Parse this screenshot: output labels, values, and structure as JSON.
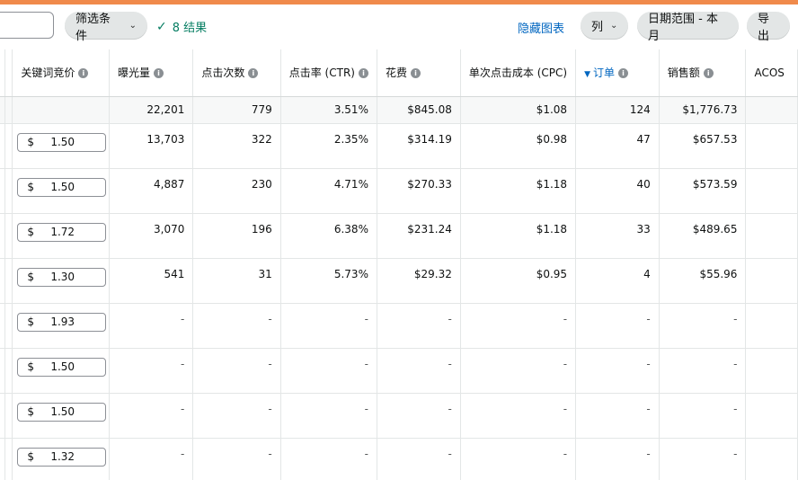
{
  "toolbar": {
    "filter_label": "筛选条件",
    "result_text": "8 结果",
    "hide_chart_label": "隐藏图表",
    "columns_label": "列",
    "date_range_label": "日期范围 - 本月",
    "export_label": "导出"
  },
  "colors": {
    "accent_top": "#f08a4b",
    "link": "#0066c0",
    "success": "#067d62"
  },
  "table": {
    "headers": [
      "关键词竞价",
      "曝光量",
      "点击次数",
      "点击率 (CTR)",
      "花费",
      "单次点击成本 (CPC)",
      "订单",
      "销售额",
      "ACOS"
    ],
    "sorted_header": "订单",
    "summary": [
      "",
      "22,201",
      "779",
      "3.51%",
      "$845.08",
      "$1.08",
      "124",
      "$1,776.73",
      ""
    ],
    "currency": "$",
    "rows": [
      {
        "bid": "1.50",
        "cells": [
          "13,703",
          "322",
          "2.35%",
          "$314.19",
          "$0.98",
          "47",
          "$657.53",
          ""
        ]
      },
      {
        "bid": "1.50",
        "cells": [
          "4,887",
          "230",
          "4.71%",
          "$270.33",
          "$1.18",
          "40",
          "$573.59",
          ""
        ]
      },
      {
        "bid": "1.72",
        "cells": [
          "3,070",
          "196",
          "6.38%",
          "$231.24",
          "$1.18",
          "33",
          "$489.65",
          ""
        ]
      },
      {
        "bid": "1.30",
        "cells": [
          "541",
          "31",
          "5.73%",
          "$29.32",
          "$0.95",
          "4",
          "$55.96",
          ""
        ]
      },
      {
        "bid": "1.93",
        "cells": [
          "-",
          "-",
          "-",
          "-",
          "-",
          "-",
          "-",
          ""
        ]
      },
      {
        "bid": "1.50",
        "cells": [
          "-",
          "-",
          "-",
          "-",
          "-",
          "-",
          "-",
          ""
        ]
      },
      {
        "bid": "1.50",
        "cells": [
          "-",
          "-",
          "-",
          "-",
          "-",
          "-",
          "-",
          ""
        ]
      },
      {
        "bid": "1.32",
        "cells": [
          "-",
          "-",
          "-",
          "-",
          "-",
          "-",
          "-",
          ""
        ]
      }
    ]
  }
}
